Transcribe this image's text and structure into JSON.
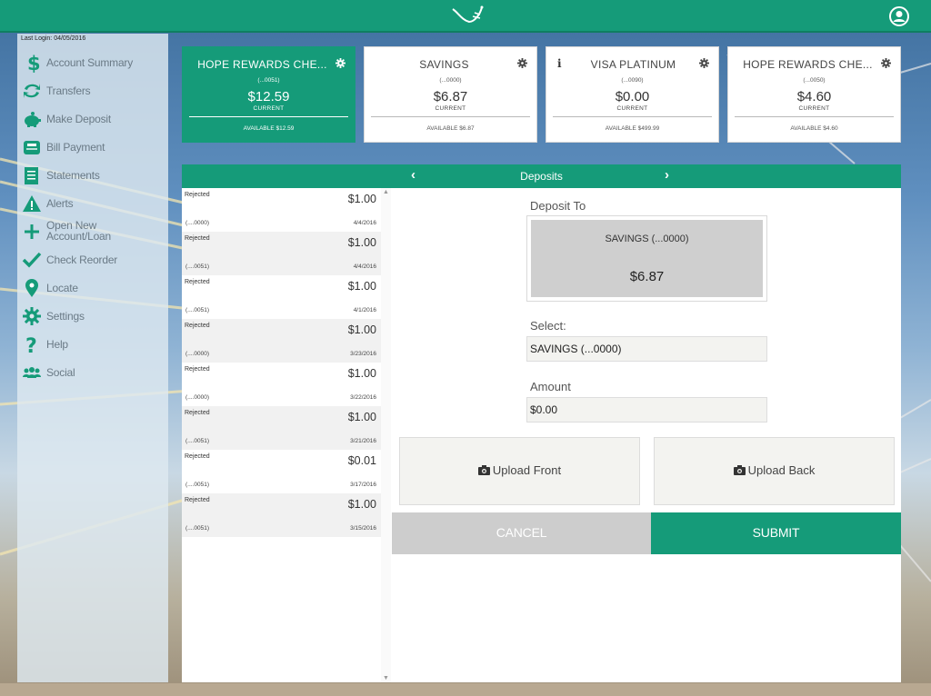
{
  "colors": {
    "brand": "#159b79",
    "brand_dark": "#0f7e61",
    "cancel": "#cdcdcd",
    "text_muted": "#6a7a86"
  },
  "header": {
    "logo_icon": "bird-logo-icon",
    "user_icon": "user-profile-icon"
  },
  "sidebar": {
    "last_login": "Last Login: 04/05/2016",
    "items": [
      {
        "label": "Account Summary",
        "icon": "dollar-icon"
      },
      {
        "label": "Transfers",
        "icon": "transfer-arrows-icon"
      },
      {
        "label": "Make Deposit",
        "icon": "piggy-bank-icon"
      },
      {
        "label": "Bill Payment",
        "icon": "bill-icon"
      },
      {
        "label": "Statements",
        "icon": "document-icon"
      },
      {
        "label": "Alerts",
        "icon": "warning-icon"
      },
      {
        "label": "Open New Account/Loan",
        "icon": "plus-icon"
      },
      {
        "label": "Check Reorder",
        "icon": "checkmark-icon"
      },
      {
        "label": "Locate",
        "icon": "map-pin-icon"
      },
      {
        "label": "Settings",
        "icon": "gear-icon"
      },
      {
        "label": "Help",
        "icon": "question-icon"
      },
      {
        "label": "Social",
        "icon": "people-icon"
      }
    ]
  },
  "accounts": [
    {
      "name": "HOPE REWARDS CHE...",
      "number": "(...0051)",
      "balance": "$12.59",
      "current_label": "CURRENT",
      "available": "AVAILABLE $12.59",
      "active": true
    },
    {
      "name": "SAVINGS",
      "number": "(...0000)",
      "balance": "$6.87",
      "current_label": "CURRENT",
      "available": "AVAILABLE $6.87",
      "active": false
    },
    {
      "name": "VISA PLATINUM",
      "number": "(...0090)",
      "balance": "$0.00",
      "current_label": "CURRENT",
      "available": "AVAILABLE $499.99",
      "active": false,
      "info": "i"
    },
    {
      "name": "HOPE REWARDS CHE...",
      "number": "(...0050)",
      "balance": "$4.60",
      "current_label": "CURRENT",
      "available": "AVAILABLE $4.60",
      "active": false
    }
  ],
  "panel": {
    "title": "Deposits",
    "prev_arrow": "‹",
    "next_arrow": "›"
  },
  "transactions": [
    {
      "status": "Rejected",
      "amount": "$1.00",
      "account": "(....0000)",
      "date": "4/4/2016"
    },
    {
      "status": "Rejected",
      "amount": "$1.00",
      "account": "(....0051)",
      "date": "4/4/2016"
    },
    {
      "status": "Rejected",
      "amount": "$1.00",
      "account": "(....0051)",
      "date": "4/1/2016"
    },
    {
      "status": "Rejected",
      "amount": "$1.00",
      "account": "(....0000)",
      "date": "3/23/2016"
    },
    {
      "status": "Rejected",
      "amount": "$1.00",
      "account": "(....0000)",
      "date": "3/22/2016"
    },
    {
      "status": "Rejected",
      "amount": "$1.00",
      "account": "(....0051)",
      "date": "3/21/2016"
    },
    {
      "status": "Rejected",
      "amount": "$0.01",
      "account": "(....0051)",
      "date": "3/17/2016"
    },
    {
      "status": "Rejected",
      "amount": "$1.00",
      "account": "(....0051)",
      "date": "3/15/2016"
    }
  ],
  "deposit_form": {
    "deposit_to_label": "Deposit To",
    "deposit_to_account": "SAVINGS (...0000)",
    "deposit_to_balance": "$6.87",
    "select_label": "Select:",
    "select_value": "SAVINGS (...0000)",
    "amount_label": "Amount",
    "amount_value": "$0.00",
    "upload_front": "Upload Front",
    "upload_back": "Upload Back",
    "cancel": "CANCEL",
    "submit": "SUBMIT"
  }
}
